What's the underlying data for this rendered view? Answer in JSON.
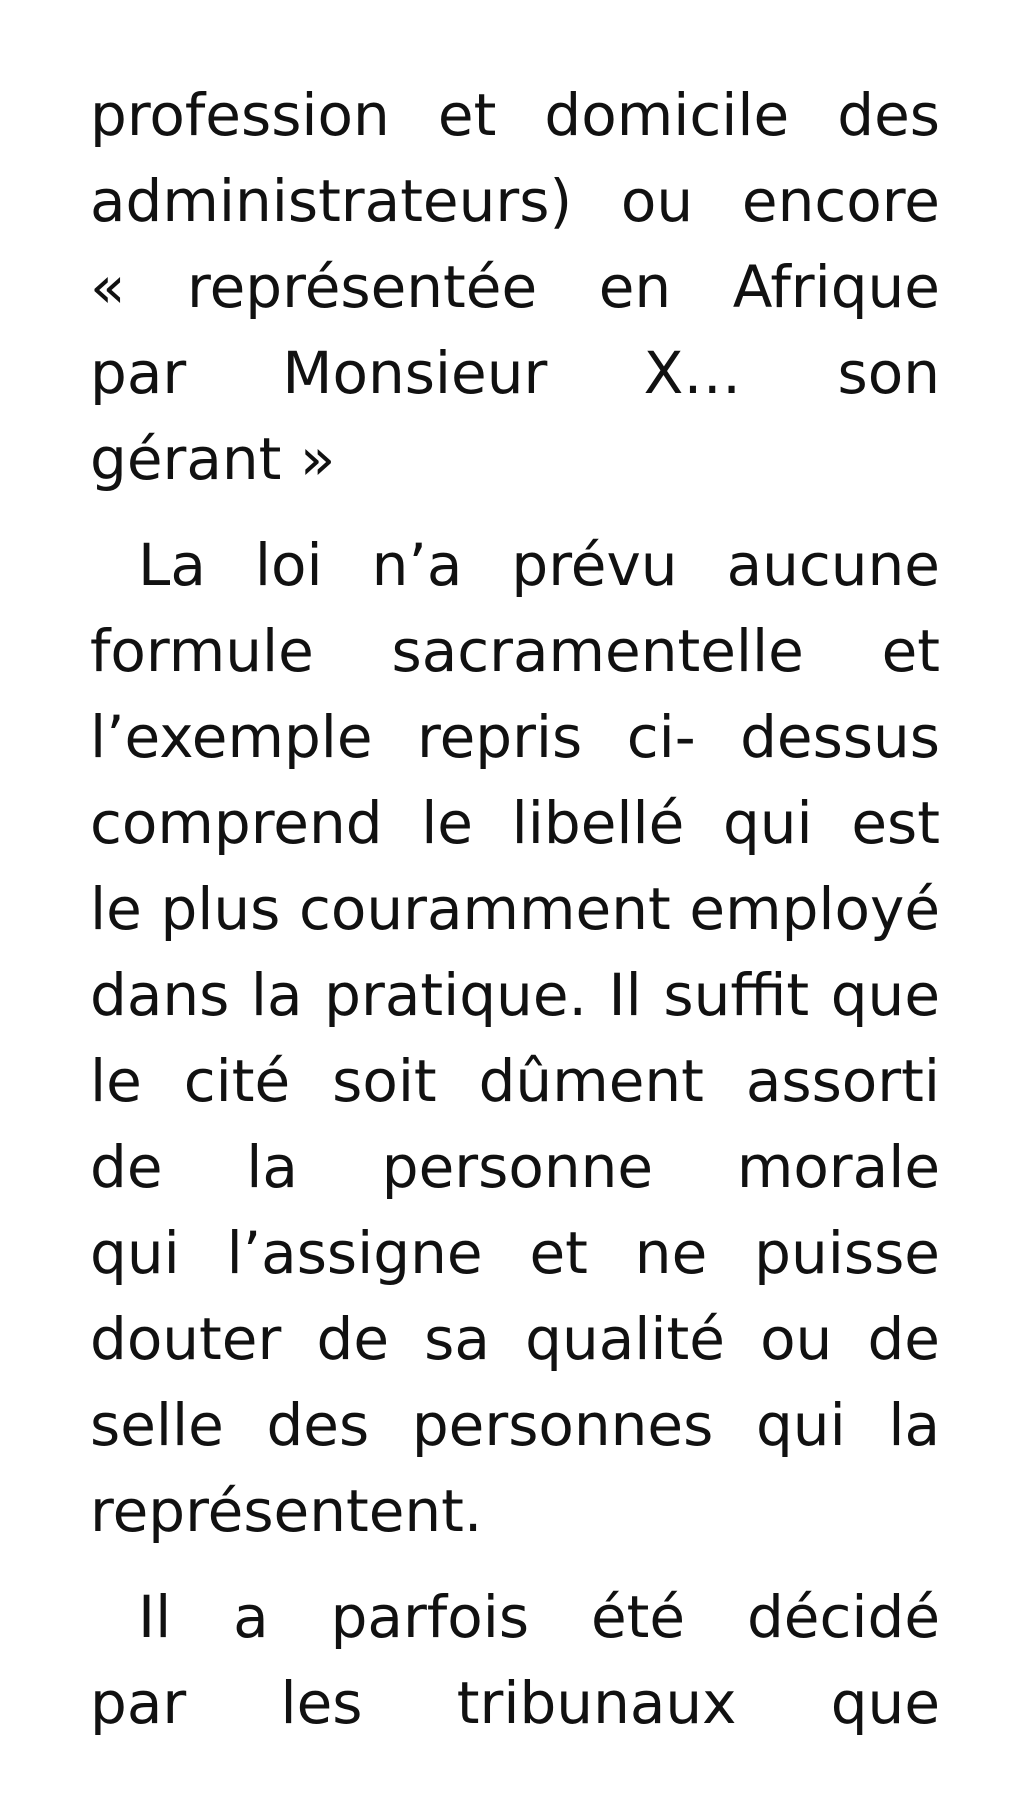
{
  "document": {
    "paragraphs": [
      {
        "lines": [
          "profession et domicile des",
          "administrateurs) ou encore",
          "« représentée en Afrique",
          "par Monsieur X… son",
          "gérant »"
        ]
      },
      {
        "lines": [
          "La loi n’a prévu aucune",
          "formule sacramentelle et",
          "l’exemple repris ci- dessus",
          "comprend le libellé qui est",
          "le plus couramment employé",
          "dans la pratique. Il suffit que",
          "le cité soit dûment assorti",
          "de la personne morale",
          "qui l’assigne et ne puisse",
          "douter de sa qualité ou de",
          "selle des personnes qui la",
          "représentent."
        ]
      },
      {
        "lines": [
          "Il a parfois été décidé",
          "par les tribunaux que"
        ]
      }
    ]
  }
}
